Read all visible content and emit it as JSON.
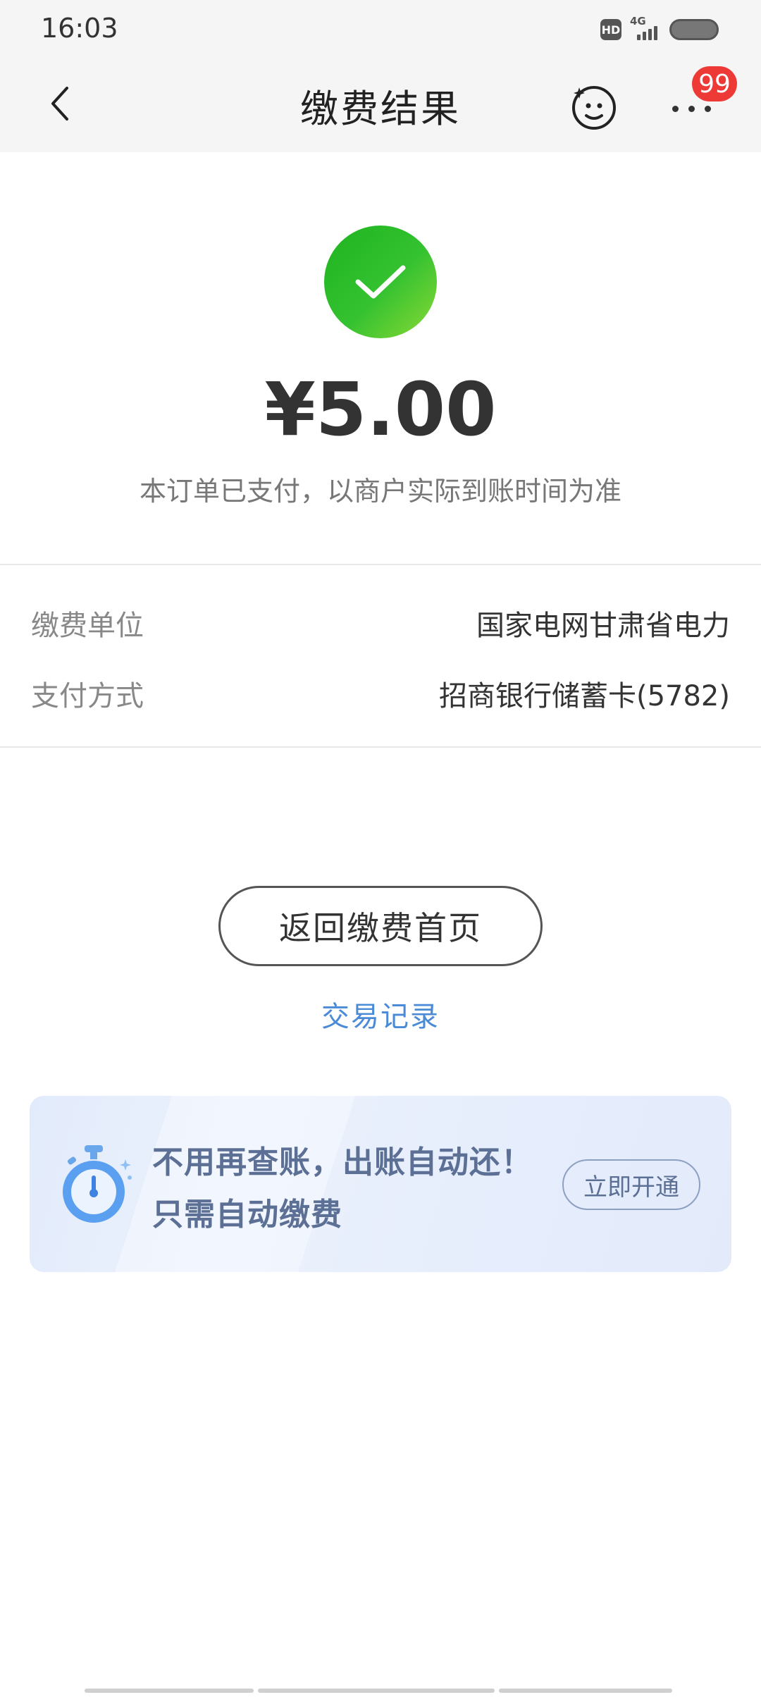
{
  "status_bar": {
    "time": "16:03",
    "hd_label": "HD",
    "network": "4G"
  },
  "navbar": {
    "title": "缴费结果",
    "badge_count": "99"
  },
  "result": {
    "amount": "¥5.00",
    "note": "本订单已支付，以商户实际到账时间为准",
    "status_color": "#29b82a"
  },
  "details": [
    {
      "label": "缴费单位",
      "value": "国家电网甘肃省电力"
    },
    {
      "label": "支付方式",
      "value": "招商银行储蓄卡(5782)"
    }
  ],
  "actions": {
    "return_label": "返回缴费首页",
    "records_label": "交易记录"
  },
  "promo": {
    "line1": "不用再查账，出账自动还！",
    "line2": "只需自动缴费",
    "button_label": "立即开通",
    "icon": "stopwatch-icon"
  },
  "colors": {
    "link": "#4a8ad6",
    "badge": "#ee3a36",
    "promo_text": "#5c6f94"
  }
}
